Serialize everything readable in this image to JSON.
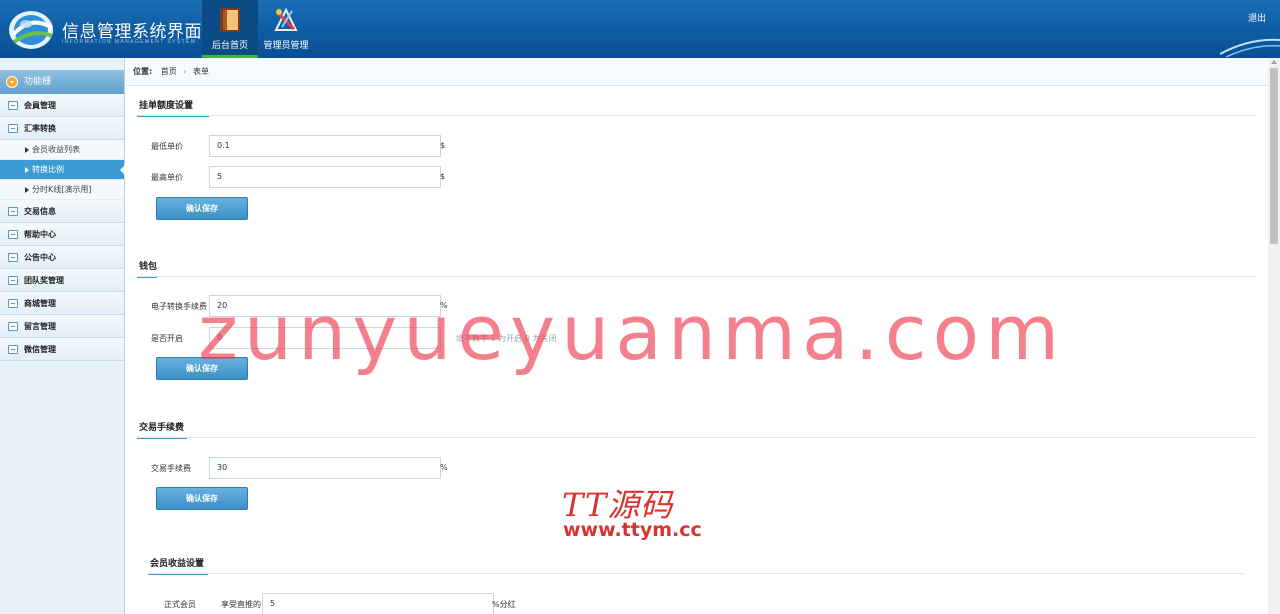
{
  "header": {
    "app_title": "信息管理系统界面",
    "app_subtitle": "INFORMATION MANAGEMENT SYSTEM",
    "nav": [
      {
        "label": "后台首页",
        "icon": "book-icon",
        "active": true
      },
      {
        "label": "管理员管理",
        "icon": "tools-icon",
        "active": false
      }
    ],
    "logout": "退出"
  },
  "sidebar": {
    "head": "功能栅",
    "items": [
      {
        "label": "会員管理",
        "icon": "list-icon"
      },
      {
        "label": "汇率转换",
        "icon": "chat-icon"
      },
      {
        "label": "交易信息",
        "icon": "list-icon"
      },
      {
        "label": "帮助中心",
        "icon": "edit-icon"
      },
      {
        "label": "公告中心",
        "icon": "edit-icon"
      },
      {
        "label": "团队奖管理",
        "icon": "calendar-icon"
      },
      {
        "label": "商城管理",
        "icon": "calendar-icon"
      },
      {
        "label": "留言管理",
        "icon": "edit-icon"
      },
      {
        "label": "微信管理",
        "icon": "chat-icon"
      }
    ],
    "sub_items": [
      {
        "label": "会员收益列表",
        "active": false
      },
      {
        "label": "转换比例",
        "active": true
      },
      {
        "label": "分时K线[演示用]",
        "active": false
      }
    ]
  },
  "breadcrumb": {
    "label": "位置:",
    "items": [
      "首页",
      "表单"
    ]
  },
  "sections": [
    {
      "title": "挂单额度设置",
      "fields": [
        {
          "label": "最低单价",
          "value": "0.1",
          "unit": "$"
        },
        {
          "label": "最高单价",
          "value": "5",
          "unit": "$"
        }
      ],
      "button": "确认保存"
    },
    {
      "title": "钱包",
      "fields": [
        {
          "label": "电子转换手续费",
          "value": "20",
          "unit": "%"
        },
        {
          "label": "是否开启",
          "value": "0",
          "hint": "填写数字 1 为开启 0 为关闭"
        }
      ],
      "button": "确认保存"
    },
    {
      "title": "交易手续费",
      "fields": [
        {
          "label": "交易手续费",
          "value": "30",
          "unit": "%"
        }
      ],
      "button": "确认保存"
    },
    {
      "title": "会员收益设置",
      "fields": [
        {
          "label": "正式会员",
          "sublabel": "享受直推的",
          "value": "5",
          "unit": "%分红"
        }
      ]
    }
  ],
  "watermarks": {
    "big": "zunyueyuanma.com",
    "logo_text": "TT源码",
    "url": "www.ttym.cc"
  },
  "colors": {
    "header_blue": "#0e5ca3",
    "accent": "#3d9bd3",
    "watermark_pink": "#f03c50",
    "watermark_red": "#d8342f"
  }
}
